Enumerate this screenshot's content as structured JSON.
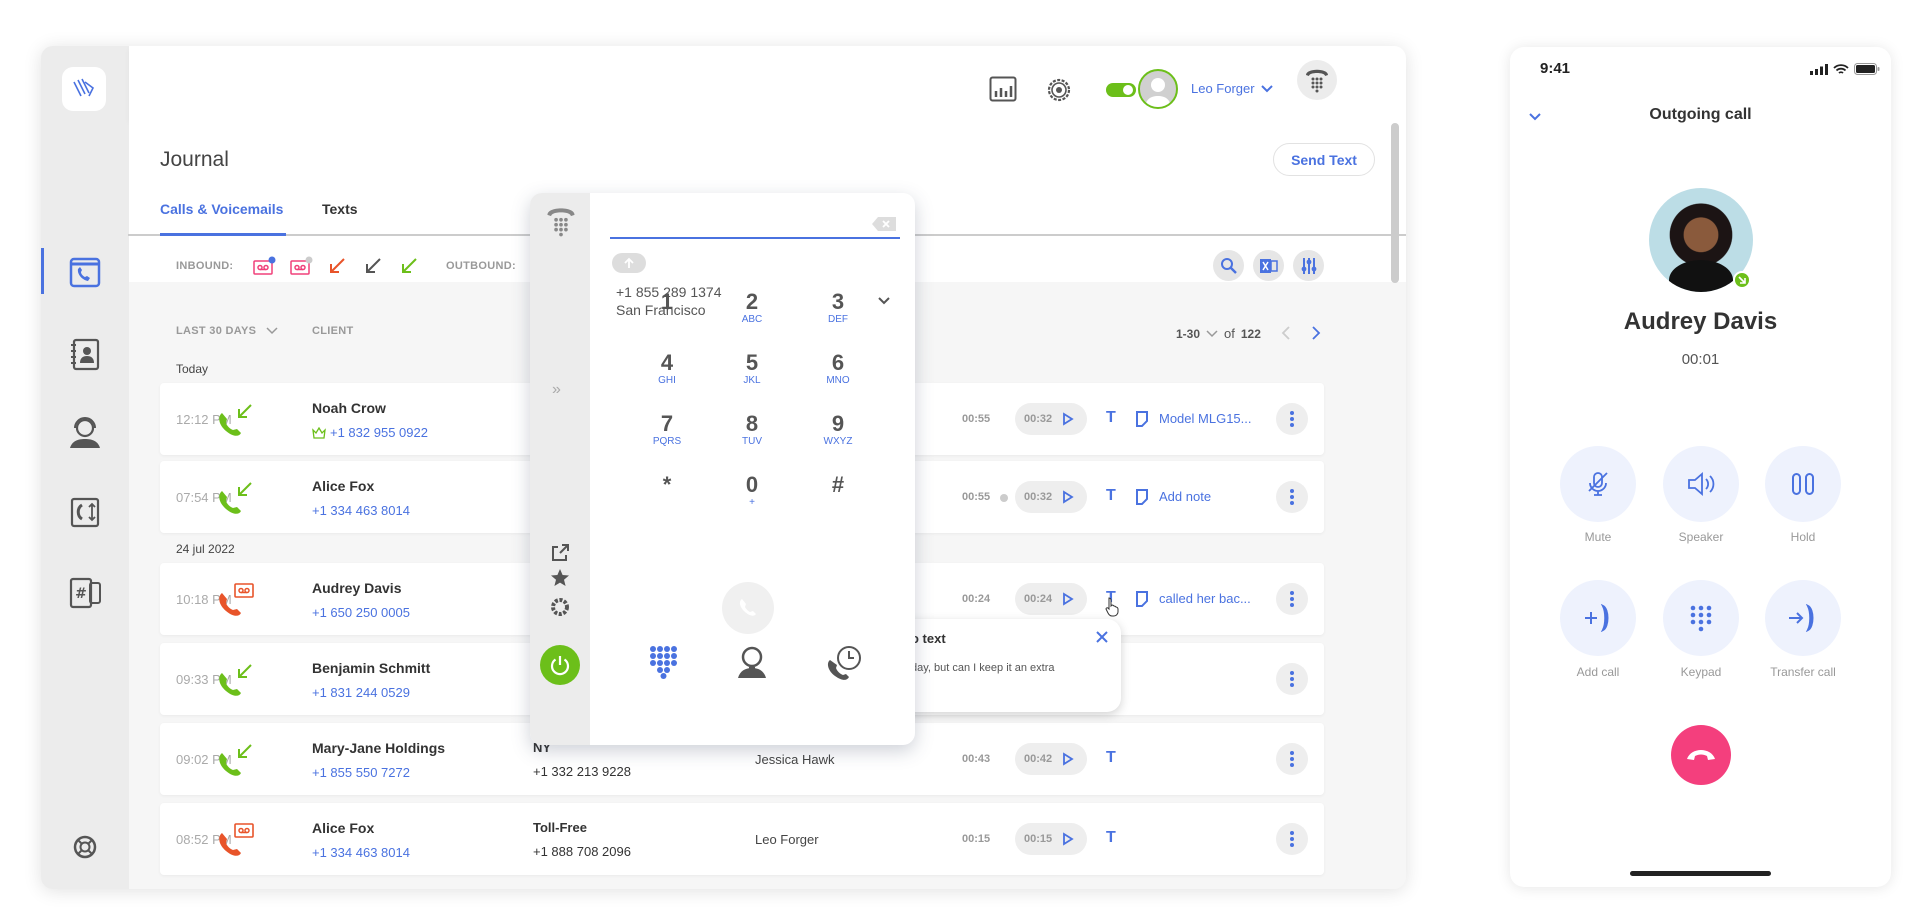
{
  "colors": {
    "accent": "#4a72e0",
    "answered": "#6cbf1a",
    "voicemail": "#e8542a",
    "hangup": "#f43f7d"
  },
  "topbar": {
    "user_name": "Leo Forger",
    "status_toggle": "on"
  },
  "journal": {
    "title": "Journal",
    "send_text_label": "Send Text",
    "tabs": [
      {
        "label": "Calls & Voicemails",
        "active": true
      },
      {
        "label": "Texts",
        "active": false
      }
    ],
    "filters": {
      "inbound_label": "INBOUND:",
      "outbound_label": "OUTBOUND:"
    },
    "columns": {
      "period": "LAST 30 DAYS",
      "client": "CLIENT"
    },
    "pagination": {
      "range": "1-30",
      "of": "of",
      "total": "122"
    },
    "groups": [
      "Today",
      "24 jul 2022"
    ],
    "rows": [
      {
        "time": "12:12 PM",
        "type": "inbound-answered",
        "name": "Noah Crow",
        "phone": "+1 832 955 0922",
        "vip": true,
        "duration": "00:55",
        "recording": "00:32",
        "note": "Model MLG15..."
      },
      {
        "time": "07:54 PM",
        "type": "inbound-answered",
        "name": "Alice Fox",
        "phone": "+1 334 463 8014",
        "duration": "00:55",
        "recording": "00:32",
        "note": "Add note",
        "unheard": true
      },
      {
        "time": "10:18 PM",
        "type": "voicemail",
        "name": "Audrey Davis",
        "phone": "+1 650 250 0005",
        "duration": "00:24",
        "recording": "00:24",
        "note": "called her bac..."
      },
      {
        "time": "09:33 PM",
        "type": "inbound-answered",
        "name": "Benjamin Schmitt",
        "phone": "+1 831 244 0529"
      },
      {
        "time": "09:02 PM",
        "type": "inbound-answered",
        "name": "Mary-Jane Holdings",
        "phone": "+1 855 550 7272",
        "line": "NY",
        "line_number": "+1 332 213 9228",
        "agent": "Jessica Hawk",
        "duration": "00:43",
        "recording": "00:42"
      },
      {
        "time": "08:52 PM",
        "type": "voicemail",
        "name": "Alice Fox",
        "phone": "+1 334 463 8014",
        "line": "Toll-Free",
        "line_number": "+1 888 708 2096",
        "agent": "Leo Forger",
        "duration": "00:15",
        "recording": "00:15"
      }
    ]
  },
  "tooltip": {
    "title": "o text",
    "body": "day, but can I keep it an extra"
  },
  "dialer": {
    "caller_id_number": "+1 855 289 1374",
    "caller_id_city": "San Francisco",
    "input_value": "",
    "keys": [
      {
        "d": "1",
        "s": ""
      },
      {
        "d": "2",
        "s": "ABC"
      },
      {
        "d": "3",
        "s": "DEF"
      },
      {
        "d": "4",
        "s": "GHI"
      },
      {
        "d": "5",
        "s": "JKL"
      },
      {
        "d": "6",
        "s": "MNO"
      },
      {
        "d": "7",
        "s": "PQRS"
      },
      {
        "d": "8",
        "s": "TUV"
      },
      {
        "d": "9",
        "s": "WXYZ"
      },
      {
        "d": "*",
        "s": ""
      },
      {
        "d": "0",
        "s": "+"
      },
      {
        "d": "#",
        "s": ""
      }
    ]
  },
  "phone": {
    "clock": "9:41",
    "header": "Outgoing call",
    "contact_name": "Audrey Davis",
    "timer": "00:01",
    "actions": [
      {
        "label": "Mute"
      },
      {
        "label": "Speaker"
      },
      {
        "label": "Hold"
      },
      {
        "label": "Add call"
      },
      {
        "label": "Keypad"
      },
      {
        "label": "Transfer call"
      }
    ]
  }
}
